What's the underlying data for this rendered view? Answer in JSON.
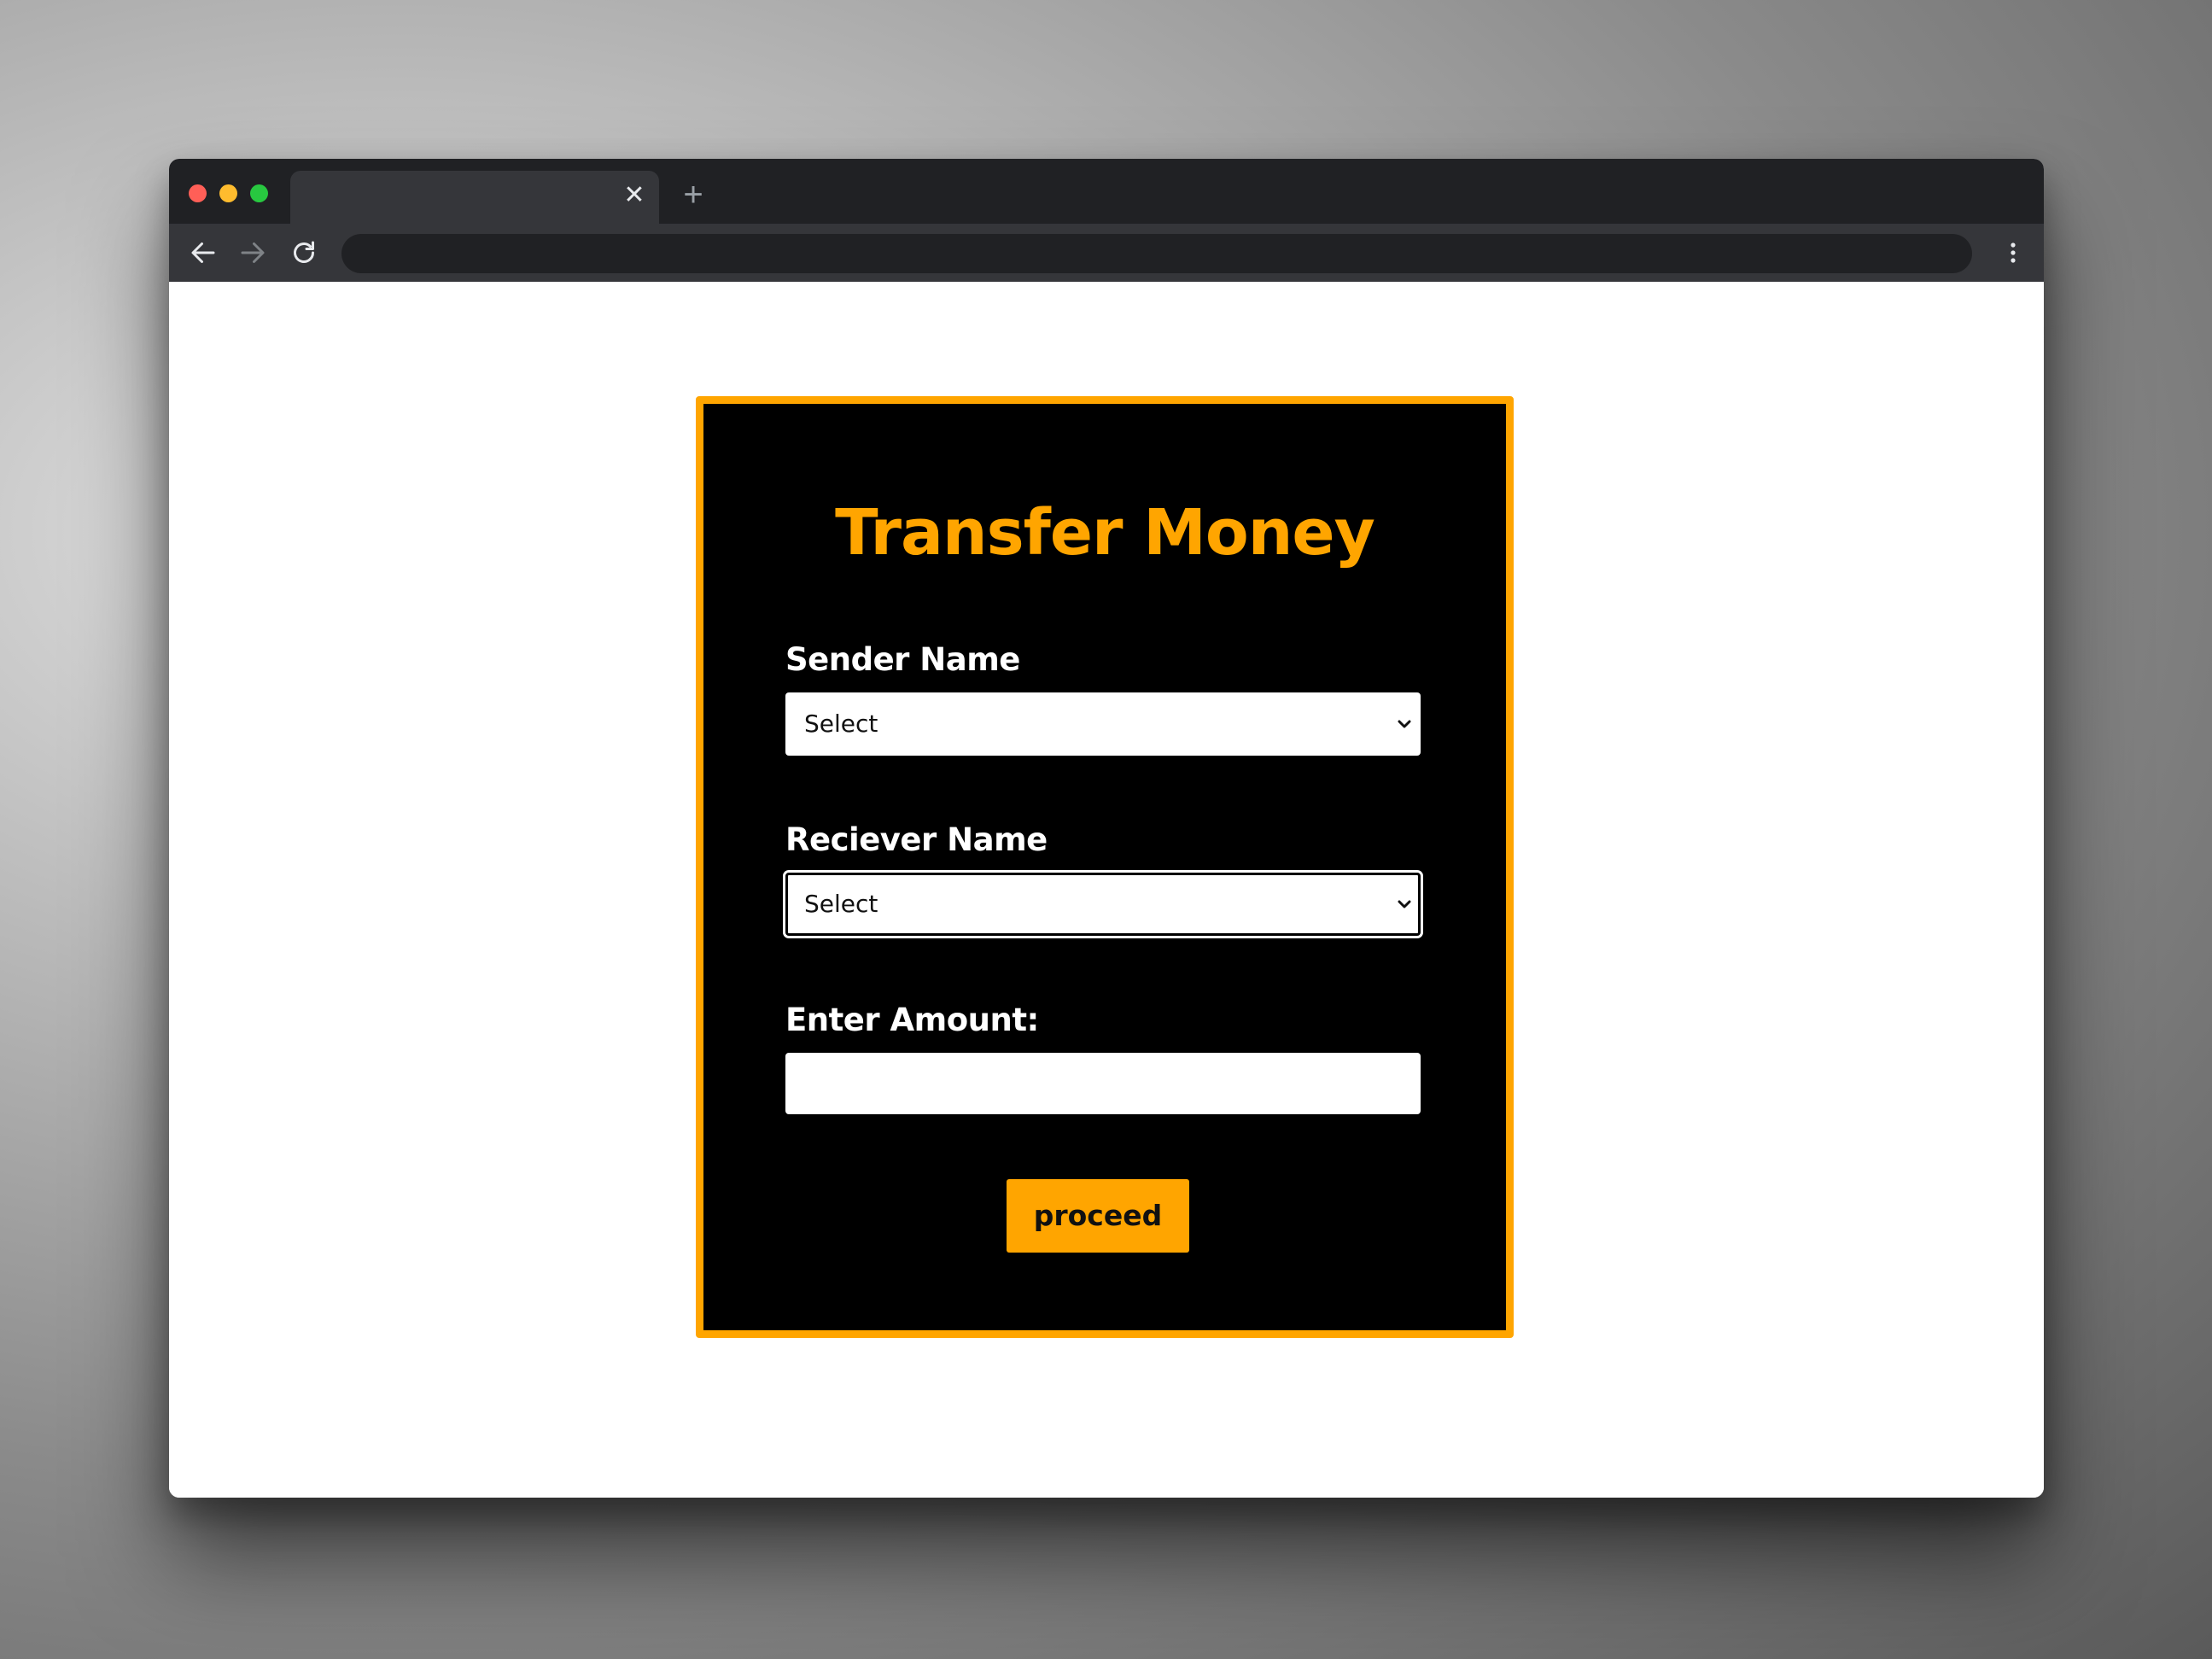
{
  "browser": {
    "tab_close_glyph": "✕",
    "new_tab_glyph": "+",
    "address": ""
  },
  "form": {
    "title": "Transfer Money",
    "sender_label": "Sender Name",
    "sender_value": "Select",
    "receiver_label": "Reciever Name",
    "receiver_value": "Select",
    "amount_label": "Enter Amount:",
    "amount_value": "",
    "proceed_label": "proceed"
  },
  "colors": {
    "accent": "#ffa500",
    "card_background": "#000000",
    "page_background": "#ffffff",
    "browser_chrome": "#202124"
  }
}
